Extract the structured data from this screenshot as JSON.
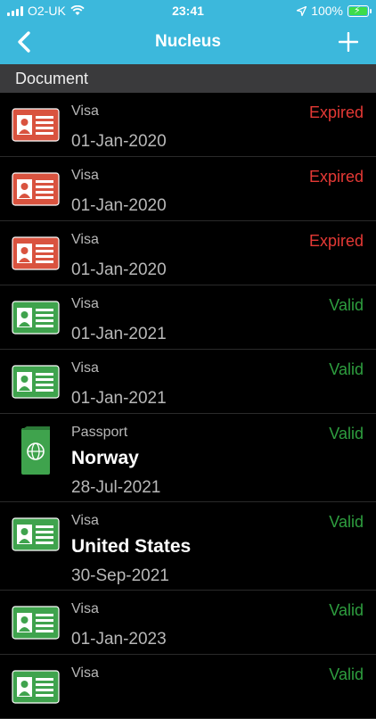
{
  "status_bar": {
    "carrier": "O2-UK",
    "time": "23:41",
    "battery": "100%",
    "battery_level": 100
  },
  "nav": {
    "title": "Nucleus",
    "back_icon": "chevron-left-icon",
    "add_icon": "plus-icon"
  },
  "section": {
    "title": "Document"
  },
  "colors": {
    "header": "#3cb8dc",
    "expired": "#e53935",
    "valid": "#2e9e3f",
    "card_red": "#d9533f",
    "card_green": "#3fa34d"
  },
  "documents": [
    {
      "type": "Visa",
      "status": "Expired",
      "date": "01-Jan-2020",
      "icon": "id-card-icon"
    },
    {
      "type": "Visa",
      "status": "Expired",
      "date": "01-Jan-2020",
      "icon": "id-card-icon"
    },
    {
      "type": "Visa",
      "status": "Expired",
      "date": "01-Jan-2020",
      "icon": "id-card-icon"
    },
    {
      "type": "Visa",
      "status": "Valid",
      "date": "01-Jan-2021",
      "icon": "id-card-icon"
    },
    {
      "type": "Visa",
      "status": "Valid",
      "date": "01-Jan-2021",
      "icon": "id-card-icon"
    },
    {
      "type": "Passport",
      "status": "Valid",
      "name": "Norway",
      "date": "28-Jul-2021",
      "icon": "passport-icon"
    },
    {
      "type": "Visa",
      "status": "Valid",
      "name": "United States",
      "date": "30-Sep-2021",
      "icon": "id-card-icon"
    },
    {
      "type": "Visa",
      "status": "Valid",
      "date": "01-Jan-2023",
      "icon": "id-card-icon"
    },
    {
      "type": "Visa",
      "status": "Valid",
      "date": "",
      "icon": "id-card-icon"
    }
  ]
}
